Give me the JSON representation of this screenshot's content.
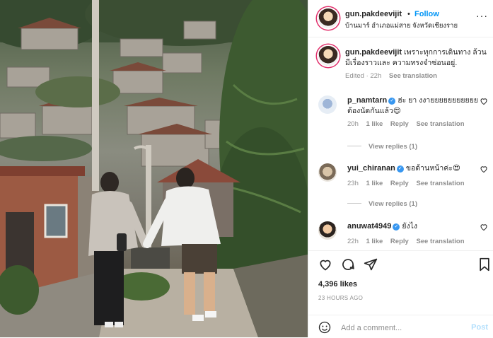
{
  "post": {
    "author": "gun.pakdeevijit",
    "follow_label": "Follow",
    "separator": "•",
    "location": "บ้านมาร์ อำเภอแม่สาย จังหวัดเชียงราย",
    "more_icon": "more-horizontal-icon"
  },
  "caption": {
    "username": "gun.pakdeevijit",
    "text": "เพราะทุกการเดินทาง ล้วนมีเรื่องราวและ ความทรงจำซ่อนอยู่.",
    "edited": "Edited · 22h",
    "see_translation": "See translation"
  },
  "comments": [
    {
      "username": "p_namtarn",
      "text": "ฮ่ะ ยา งงายยยยยยยยยยย ต้องนัดกันแล้ว😍",
      "time": "20h",
      "likes": "1 like",
      "reply": "Reply",
      "see_translation": "See translation",
      "view_replies": "View replies (1)"
    },
    {
      "username": "yui_chiranan",
      "text": "ขอด้านหน้าค่ะ😍",
      "time": "23h",
      "likes": "1 like",
      "reply": "Reply",
      "see_translation": "See translation",
      "view_replies": "View replies (1)"
    },
    {
      "username": "anuwat4949",
      "text": "ยังไง",
      "time": "22h",
      "likes": "1 like",
      "reply": "Reply",
      "see_translation": "See translation"
    }
  ],
  "actions": {
    "like_icon": "heart-icon",
    "comment_icon": "comment-icon",
    "share_icon": "send-icon",
    "save_icon": "bookmark-icon"
  },
  "likes_count": "4,396 likes",
  "posted_ago": "23 HOURS AGO",
  "comment_box": {
    "placeholder": "Add a comment...",
    "post_label": "Post",
    "emoji_icon": "smiley-icon"
  },
  "colors": {
    "link_blue": "#0095f6",
    "post_disabled": "#b2dffc",
    "verified": "#3897f0",
    "muted": "#8e8e8e"
  }
}
